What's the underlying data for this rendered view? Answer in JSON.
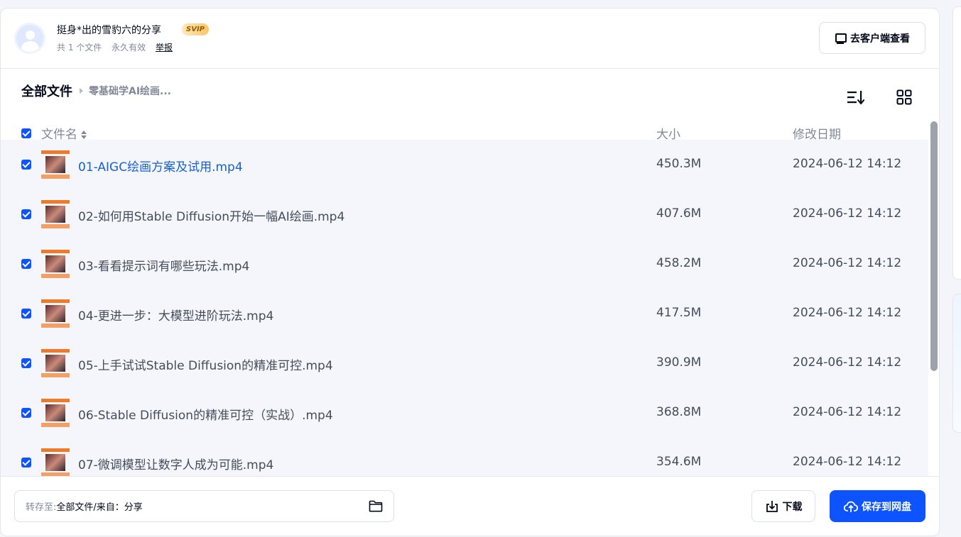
{
  "header": {
    "sharer_name": "挺身*出的雪豹六的分享",
    "badge": "SVIP",
    "file_count": "共 1 个文件",
    "validity": "永久有效",
    "report": "举报",
    "client_button": "去客户端查看"
  },
  "breadcrumb": {
    "root": "全部文件",
    "current": "零基础学AI绘画..."
  },
  "table": {
    "col_name": "文件名",
    "col_size": "大小",
    "col_date": "修改日期",
    "rows": [
      {
        "name": "01-AIGC绘画方案及试用.mp4",
        "size": "450.3M",
        "date": "2024-06-12 14:12"
      },
      {
        "name": "02-如何用Stable Diffusion开始一幅AI绘画.mp4",
        "size": "407.6M",
        "date": "2024-06-12 14:12"
      },
      {
        "name": "03-看看提示词有哪些玩法.mp4",
        "size": "458.2M",
        "date": "2024-06-12 14:12"
      },
      {
        "name": "04-更进一步：大模型进阶玩法.mp4",
        "size": "417.5M",
        "date": "2024-06-12 14:12"
      },
      {
        "name": "05-上手试试Stable Diffusion的精准可控.mp4",
        "size": "390.9M",
        "date": "2024-06-12 14:12"
      },
      {
        "name": "06-Stable Diffusion的精准可控（实战）.mp4",
        "size": "368.8M",
        "date": "2024-06-12 14:12"
      },
      {
        "name": "07-微调模型让数字人成为可能.mp4",
        "size": "354.6M",
        "date": "2024-06-12 14:12"
      }
    ]
  },
  "footer": {
    "save_to_label": "转存至:",
    "save_to_path": "全部文件/来自：分享",
    "download": "下载",
    "save": "保存到网盘"
  },
  "colors": {
    "accent": "#0d53ff",
    "link": "#1660d8",
    "row_bg": "#f4f6fb"
  }
}
